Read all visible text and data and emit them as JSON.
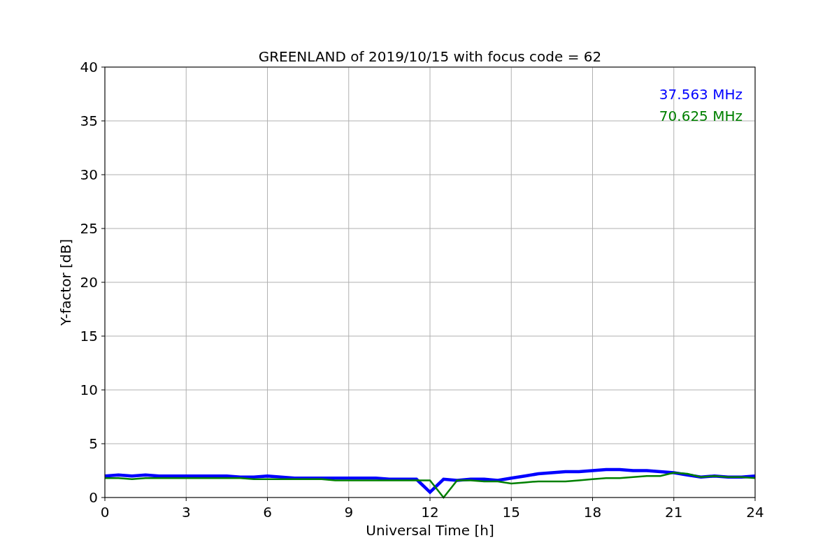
{
  "chart_data": {
    "type": "line",
    "title": "GREENLAND of 2019/10/15 with focus code = 62",
    "xlabel": "Universal Time [h]",
    "ylabel": "Y-factor [dB]",
    "x": [
      0,
      0.5,
      1,
      1.5,
      2,
      2.5,
      3,
      3.5,
      4,
      4.5,
      5,
      5.5,
      6,
      6.5,
      7,
      7.5,
      8,
      8.5,
      9,
      9.5,
      10,
      10.5,
      11,
      11.5,
      12,
      12.5,
      13,
      13.5,
      14,
      14.5,
      15,
      15.5,
      16,
      16.5,
      17,
      17.5,
      18,
      18.5,
      19,
      19.5,
      20,
      20.5,
      21,
      21.5,
      22,
      22.5,
      23,
      23.5,
      24
    ],
    "series": [
      {
        "name": "37.563 MHz",
        "color": "#0000ff",
        "values": [
          2.0,
          2.1,
          2.0,
          2.1,
          2.0,
          2.0,
          2.0,
          2.0,
          2.0,
          2.0,
          1.9,
          1.9,
          2.0,
          1.9,
          1.8,
          1.8,
          1.8,
          1.8,
          1.8,
          1.8,
          1.8,
          1.7,
          1.7,
          1.7,
          0.5,
          1.7,
          1.6,
          1.7,
          1.7,
          1.6,
          1.8,
          2.0,
          2.2,
          2.3,
          2.4,
          2.4,
          2.5,
          2.6,
          2.6,
          2.5,
          2.5,
          2.4,
          2.3,
          2.1,
          1.9,
          2.0,
          1.9,
          1.9,
          2.0
        ]
      },
      {
        "name": "70.625 MHz",
        "color": "#008000",
        "values": [
          1.8,
          1.8,
          1.7,
          1.8,
          1.8,
          1.8,
          1.8,
          1.8,
          1.8,
          1.8,
          1.8,
          1.7,
          1.7,
          1.7,
          1.7,
          1.7,
          1.7,
          1.6,
          1.6,
          1.6,
          1.6,
          1.6,
          1.6,
          1.6,
          1.6,
          0.0,
          1.6,
          1.6,
          1.5,
          1.5,
          1.3,
          1.4,
          1.5,
          1.5,
          1.5,
          1.6,
          1.7,
          1.8,
          1.8,
          1.9,
          2.0,
          2.0,
          2.3,
          2.2,
          1.9,
          2.0,
          1.9,
          1.9,
          1.8
        ]
      }
    ],
    "xlim": [
      0,
      24
    ],
    "ylim": [
      0,
      40
    ],
    "xticks": [
      0,
      3,
      6,
      9,
      12,
      15,
      18,
      21,
      24
    ],
    "yticks": [
      0,
      5,
      10,
      15,
      20,
      25,
      30,
      35,
      40
    ],
    "grid": true
  }
}
